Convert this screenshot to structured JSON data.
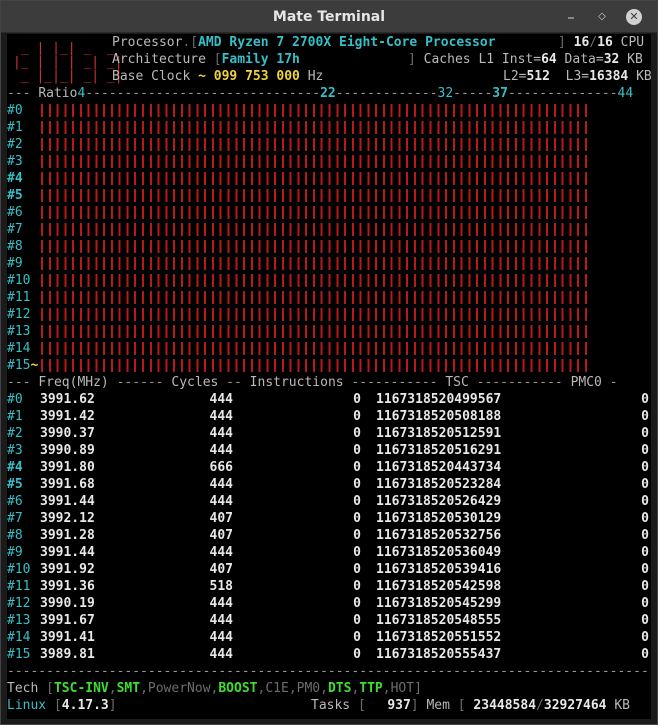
{
  "window": {
    "title": "Mate Terminal"
  },
  "header": {
    "processor_label": "Processor",
    "processor_value": "AMD Ryzen 7 2700X Eight-Core Processor",
    "cpu_online": "16",
    "cpu_total": "16",
    "cpu_label": "CPU",
    "arch_label": "Architecture",
    "arch_value": "Family 17h",
    "caches_label": "Caches L1 Inst=",
    "l1_inst": "64",
    "data_label": "Data=",
    "l1_data": "32",
    "kb": "KB",
    "clock_label": "Base Clock",
    "clock_value": "~ 099 753 000",
    "hz": "Hz",
    "l2_label": "L2=",
    "l2": "512",
    "l3_label": "L3=",
    "l3": "16384",
    "big_digits": " _ | |_| _  _\n|_ | | | _| _|\n _ |_|_| _| _|"
  },
  "ratio": {
    "label": "Ratio",
    "marks": [
      "4",
      "22",
      "32",
      "37",
      "44"
    ],
    "cores": [
      "#0",
      "#1",
      "#2",
      "#3",
      "#4",
      "#5",
      "#6",
      "#7",
      "#8",
      "#9",
      "#10",
      "#11",
      "#12",
      "#13",
      "#14",
      "#15~"
    ],
    "bold_cores": [
      4,
      5
    ]
  },
  "table": {
    "headers": [
      "Freq(MHz)",
      "Cycles",
      "Instructions",
      "TSC",
      "PMC0"
    ],
    "rows": [
      {
        "core": "#0",
        "freq": "3991.62",
        "cycles": "444",
        "instr": "0",
        "tsc": "1167318520499567",
        "pmc0": "0"
      },
      {
        "core": "#1",
        "freq": "3991.42",
        "cycles": "444",
        "instr": "0",
        "tsc": "1167318520508188",
        "pmc0": "0"
      },
      {
        "core": "#2",
        "freq": "3990.37",
        "cycles": "444",
        "instr": "0",
        "tsc": "1167318520512591",
        "pmc0": "0"
      },
      {
        "core": "#3",
        "freq": "3990.89",
        "cycles": "444",
        "instr": "0",
        "tsc": "1167318520516291",
        "pmc0": "0"
      },
      {
        "core": "#4",
        "freq": "3991.80",
        "cycles": "666",
        "instr": "0",
        "tsc": "1167318520443734",
        "pmc0": "0"
      },
      {
        "core": "#5",
        "freq": "3991.68",
        "cycles": "444",
        "instr": "0",
        "tsc": "1167318520523284",
        "pmc0": "0"
      },
      {
        "core": "#6",
        "freq": "3991.44",
        "cycles": "444",
        "instr": "0",
        "tsc": "1167318520526429",
        "pmc0": "0"
      },
      {
        "core": "#7",
        "freq": "3992.12",
        "cycles": "407",
        "instr": "0",
        "tsc": "1167318520530129",
        "pmc0": "0"
      },
      {
        "core": "#8",
        "freq": "3991.28",
        "cycles": "407",
        "instr": "0",
        "tsc": "1167318520532756",
        "pmc0": "0"
      },
      {
        "core": "#9",
        "freq": "3991.44",
        "cycles": "444",
        "instr": "0",
        "tsc": "1167318520536049",
        "pmc0": "0"
      },
      {
        "core": "#10",
        "freq": "3991.92",
        "cycles": "407",
        "instr": "0",
        "tsc": "1167318520539416",
        "pmc0": "0"
      },
      {
        "core": "#11",
        "freq": "3991.36",
        "cycles": "518",
        "instr": "0",
        "tsc": "1167318520542598",
        "pmc0": "0"
      },
      {
        "core": "#12",
        "freq": "3990.19",
        "cycles": "444",
        "instr": "0",
        "tsc": "1167318520545299",
        "pmc0": "0"
      },
      {
        "core": "#13",
        "freq": "3991.67",
        "cycles": "444",
        "instr": "0",
        "tsc": "1167318520548555",
        "pmc0": "0"
      },
      {
        "core": "#14",
        "freq": "3991.41",
        "cycles": "444",
        "instr": "0",
        "tsc": "1167318520551552",
        "pmc0": "0"
      },
      {
        "core": "#15",
        "freq": "3989.81",
        "cycles": "444",
        "instr": "0",
        "tsc": "1167318520555437",
        "pmc0": "0"
      }
    ]
  },
  "footer": {
    "tech_label": "Tech",
    "tech_flags": [
      {
        "name": "TSC-INV",
        "on": true
      },
      {
        "name": "SMT",
        "on": true
      },
      {
        "name": "PowerNow",
        "on": false
      },
      {
        "name": "BOOST",
        "on": true
      },
      {
        "name": "C1E",
        "on": false
      },
      {
        "name": "PM0",
        "on": false
      },
      {
        "name": "DTS",
        "on": true
      },
      {
        "name": "TTP",
        "on": true
      },
      {
        "name": "HOT",
        "on": false
      }
    ],
    "os": "Linux",
    "kernel": "4.17.3",
    "tasks_label": "Tasks",
    "tasks": "937",
    "mem_label": "Mem",
    "mem_used": "23448584",
    "mem_total": "32927464",
    "mem_unit": "KB"
  },
  "colors": {
    "bars": "#b8191a",
    "accent": "#35c0c8",
    "highlight": "#f0d23c",
    "enabled": "#3fde2e"
  }
}
